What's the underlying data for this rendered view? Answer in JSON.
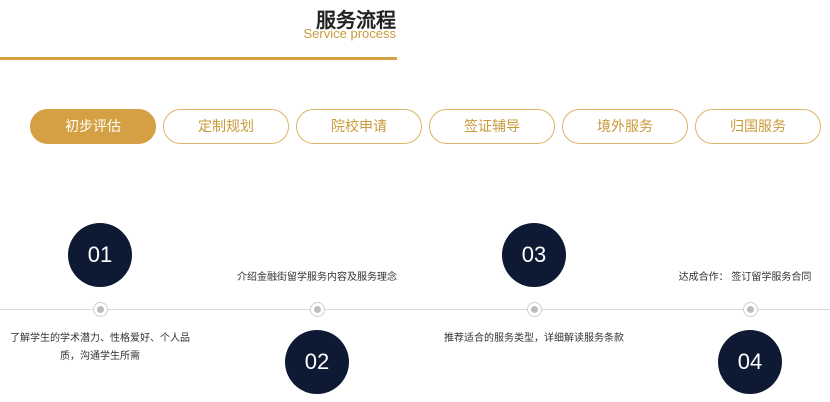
{
  "header": {
    "title": "服务流程",
    "subtitle": "Service process"
  },
  "tabs": [
    {
      "label": "初步评估",
      "active": true
    },
    {
      "label": "定制规划",
      "active": false
    },
    {
      "label": "院校申请",
      "active": false
    },
    {
      "label": "签证辅导",
      "active": false
    },
    {
      "label": "境外服务",
      "active": false
    },
    {
      "label": "归国服务",
      "active": false
    }
  ],
  "steps": [
    {
      "number": "01",
      "text": "了解学生的学术潜力、性格爱好、个人品质，沟通学生所需"
    },
    {
      "number": "02",
      "text": "介绍金融街留学服务内容及服务理念"
    },
    {
      "number": "03",
      "text": "推荐适合的服务类型，详细解读服务条款"
    },
    {
      "number": "04",
      "text": "达成合作： 签订留学服务合同"
    }
  ],
  "colors": {
    "accent": "#d4a043",
    "circle": "#0e1a33"
  }
}
